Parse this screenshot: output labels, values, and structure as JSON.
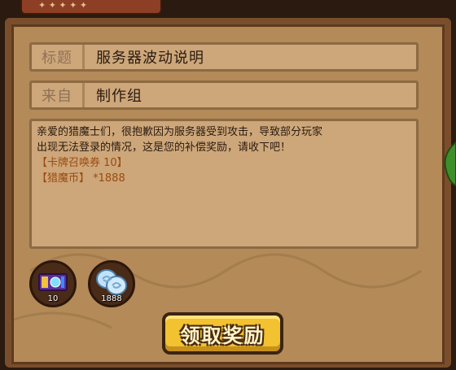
{
  "mail": {
    "title_label": "标题",
    "title_value": "服务器波动说明",
    "from_label": "来自",
    "from_value": "制作组",
    "body_line1": "亲爱的猎魔士们，很抱歉因为服务器受到攻击，导致部分玩家",
    "body_line2": "出现无法登录的情况，这是您的补偿奖励，请收下吧！",
    "item1": "【卡牌召唤券 10】",
    "item2": "【猎魔币】 *1888"
  },
  "rewards": [
    {
      "icon": "card-summon-ticket-icon",
      "count": "10"
    },
    {
      "icon": "hunter-coin-icon",
      "count": "1888"
    }
  ],
  "actions": {
    "claim_label": "领取奖励"
  },
  "colors": {
    "panel": "#b38a58",
    "field": "#cda77a",
    "button": "#f2c230",
    "item_text": "#9c4a10"
  }
}
